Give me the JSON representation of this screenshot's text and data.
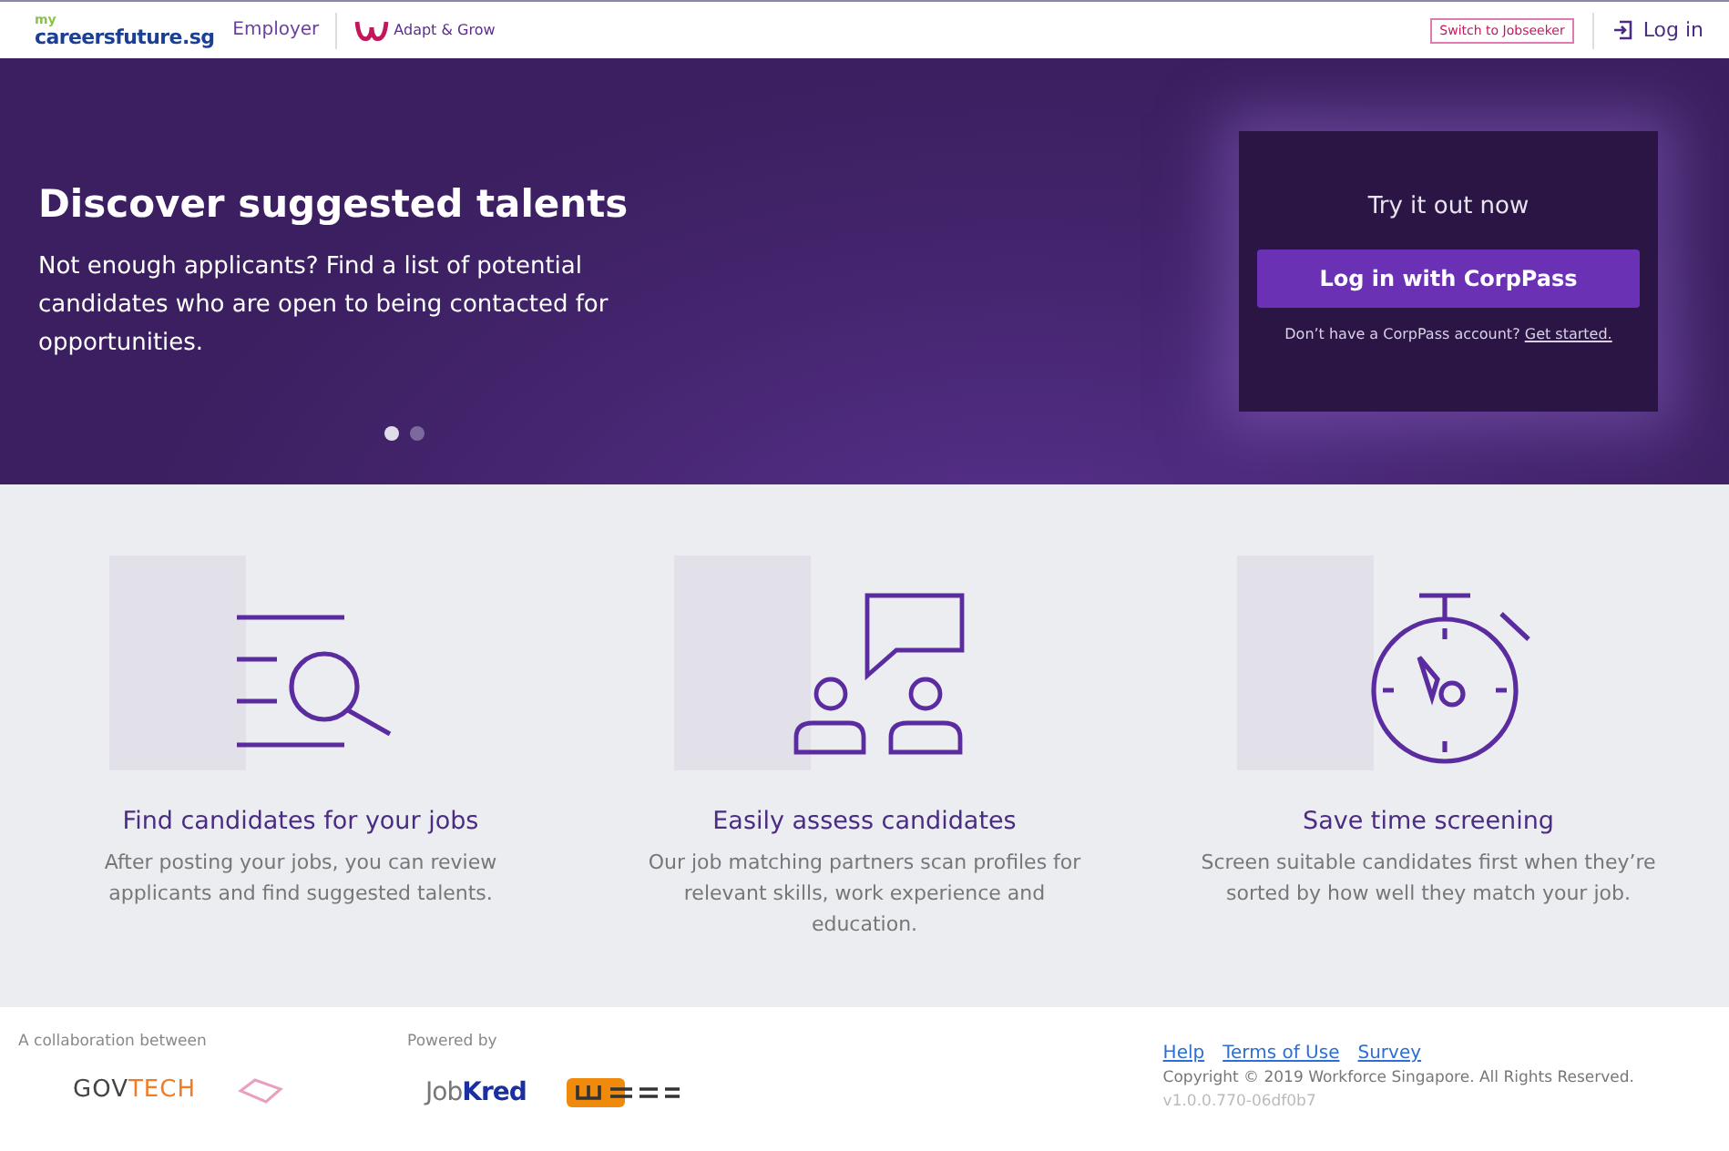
{
  "header": {
    "logo_small": "my",
    "logo": "careersfuture.sg",
    "section": "Employer",
    "partner_logo": "Adapt & Grow",
    "switch_button": "Switch to Jobseeker",
    "login": "Log in"
  },
  "hero": {
    "title": "Discover suggested talents",
    "text": "Not enough applicants? Find a list of potential candidates who are open to being contacted for opportunities.",
    "dots": [
      {
        "selected": true
      },
      {
        "selected": false
      }
    ],
    "login_card": {
      "title": "Try it out now",
      "button": "Log in with CorpPass",
      "prompt": "Don’t have a CorpPass account?",
      "link": "Get started."
    }
  },
  "features": [
    {
      "kind": "search",
      "title": "Find candidates for your jobs",
      "text": "After posting your jobs, you can review applicants and find suggested talents."
    },
    {
      "kind": "people",
      "title": "Easily assess candidates",
      "text": "Our job matching partners scan profiles for relevant skills, work experience and education."
    },
    {
      "kind": "timer",
      "title": "Save time screening",
      "text": "Screen suitable candidates first when they’re sorted by how well they match your job."
    }
  ],
  "footer": {
    "collab_label": "A collaboration between",
    "collab_logo": {
      "part1": "GOV",
      "part2": "TECH"
    },
    "powered_label": "Powered by",
    "powered_logo": {
      "part1": "Job",
      "part2": "Kred"
    },
    "links": [
      "Help",
      "Terms of Use",
      "Survey"
    ],
    "copyright": "Copyright © 2019 Workforce Singapore.  All Rights Reserved.",
    "version": "v1.0.0.770-06df0b7"
  }
}
